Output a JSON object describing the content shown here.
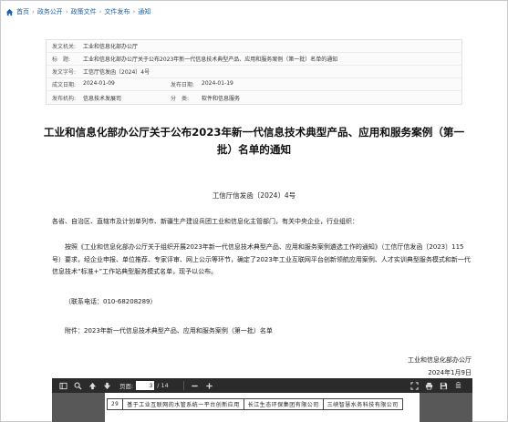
{
  "breadcrumb": {
    "items": [
      "首页",
      "政务公开",
      "政策文件",
      "文件发布",
      "通知"
    ],
    "separator": "›"
  },
  "meta": {
    "issuer_label": "发文机关:",
    "issuer_value": "工业和信息化部办公厅",
    "title_label": "标　题:",
    "title_value": "工业和信息化部办公厅关于公布2023年新一代信息技术典型产品、应用和服务案例（第一批）名单的通知",
    "doc_no_label": "发文字号:",
    "doc_no_value": "工信厅信发函〔2024〕4号",
    "written_label": "成文日期:",
    "written_value": "2024-01-09",
    "published_label": "发布日期:",
    "published_value": "2024-01-19",
    "org_label": "发布机构:",
    "org_value": "信息技术发展司",
    "category_label": "分　类:",
    "category_value": "软件和信息服务"
  },
  "document": {
    "title": "工业和信息化部办公厅关于公布2023年新一代信息技术典型产品、应用和服务案例（第一批）名单的通知",
    "doc_number": "工信厅信发函〔2024〕4号",
    "recipients": "各省、自治区、直辖市及计划单列市、新疆生产建设兵团工业和信息化主管部门，有关中央企业，行业组织：",
    "main_paragraph": "按照《工业和信息化部办公厅关于组织开展2023年新一代信息技术典型产品、应用和服务案例遴选工作的通知》（工信厅信发函〔2023〕115号）要求，经企业申报、单位推荐、专家评审、网上公示等环节，确定了2023年工业互联网平台创新领航应用案例、人才实训典型服务模式和新一代信息技术“标准+”工作站典型服务模式名单，现予以公布。",
    "contact": "（联系电话：010-68208289）",
    "attachment": "附件：2023年新一代信息技术典型产品、应用和服务案例（第一批）名单",
    "signer": "工业和信息化部办公厅",
    "date": "2024年1月9日"
  },
  "pdf_viewer": {
    "page_label": "页面:",
    "current_page": "3",
    "total_pages": "/ 14",
    "toolbar_icons": [
      "sidebar-toggle-icon",
      "search-icon",
      "arrow-up-icon",
      "arrow-down-icon",
      "zoom-out-icon",
      "zoom-in-icon",
      "fullscreen-icon",
      "print-icon",
      "save-icon",
      "more-icon"
    ],
    "table_row": {
      "index": "29",
      "product": "基于工业互联网的水管系统一平台创新应用",
      "company": "长江生态环保集团有限公司",
      "partner": "三峡智慧水务科技有限公司"
    }
  },
  "colors": {
    "link": "#1b5fa8",
    "toolbar": "#2b2b2b",
    "viewer_bg": "#585858"
  }
}
